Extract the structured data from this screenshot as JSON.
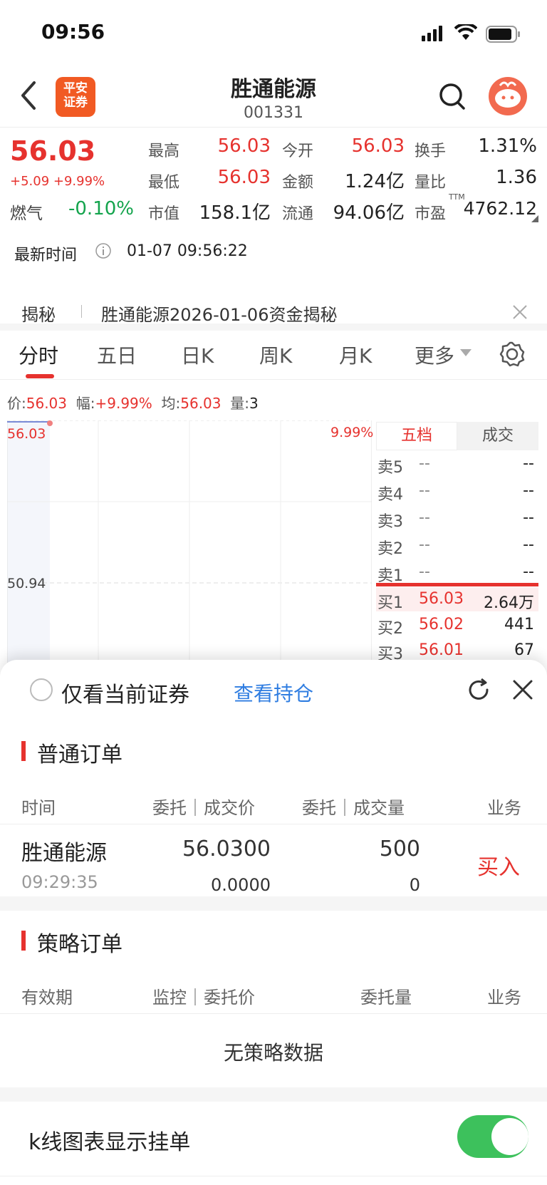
{
  "status_bar": {
    "time": "09:56"
  },
  "header": {
    "logo_text_line1": "平安",
    "logo_text_line2": "证券",
    "title": "胜通能源",
    "code": "001331"
  },
  "quote": {
    "price": "56.03",
    "change": "+5.09 +9.99%",
    "sector_name": "燃气",
    "sector_change": "-0.10%",
    "fields": [
      {
        "label": "最高",
        "value": "56.03"
      },
      {
        "label": "今开",
        "value": "56.03"
      },
      {
        "label": "换手",
        "value": "1.31%"
      },
      {
        "label": "最低",
        "value": "56.03"
      },
      {
        "label": "金额",
        "value": "1.24亿"
      },
      {
        "label": "量比",
        "value": "1.36"
      },
      {
        "label": "市值",
        "value": "158.1亿"
      },
      {
        "label": "流通",
        "value": "94.06亿"
      },
      {
        "label": "市盈",
        "value": "4762.12"
      }
    ],
    "ttm_sup": "TTM",
    "latest_time_label": "最新时间",
    "latest_time": "01-07 09:56:22"
  },
  "banner": {
    "tag": "揭秘",
    "text": "胜通能源2026-01-06资金揭秘"
  },
  "tabs": [
    "分时",
    "五日",
    "日K",
    "周K",
    "月K",
    "更多"
  ],
  "mini_stats": {
    "price_label": "价:",
    "price": "56.03",
    "amp_label": "幅:",
    "amp": "+9.99%",
    "avg_label": "均:",
    "avg": "56.03",
    "vol_label": "量:",
    "vol": "3"
  },
  "chart": {
    "top_price": "56.03",
    "top_pct": "9.99%",
    "mid_price": "50.94"
  },
  "order_book": {
    "tabs": [
      "五档",
      "成交"
    ],
    "sell": [
      {
        "label": "卖5",
        "price": "--",
        "vol": "--"
      },
      {
        "label": "卖4",
        "price": "--",
        "vol": "--"
      },
      {
        "label": "卖3",
        "price": "--",
        "vol": "--"
      },
      {
        "label": "卖2",
        "price": "--",
        "vol": "--"
      },
      {
        "label": "卖1",
        "price": "--",
        "vol": "--"
      }
    ],
    "buy": [
      {
        "label": "买1",
        "price": "56.03",
        "vol": "2.64万"
      },
      {
        "label": "买2",
        "price": "56.02",
        "vol": "441"
      },
      {
        "label": "买3",
        "price": "56.01",
        "vol": "67"
      }
    ]
  },
  "sheet": {
    "only_current_label": "仅看当前证券",
    "view_positions": "查看持仓",
    "normal_orders": {
      "title": "普通订单",
      "headers": [
        "时间",
        "委托｜成交价",
        "委托｜成交量",
        "业务"
      ],
      "rows": [
        {
          "name": "胜通能源",
          "time": "09:29:35",
          "entrust_price": "56.0300",
          "deal_price": "0.0000",
          "entrust_qty": "500",
          "deal_qty": "0",
          "action": "买入"
        }
      ]
    },
    "strategy_orders": {
      "title": "策略订单",
      "headers": [
        "有效期",
        "监控｜委托价",
        "委托量",
        "业务"
      ],
      "empty": "无策略数据"
    },
    "kline_toggle_label": "k线图表显示挂单",
    "kline_toggle_on": true
  }
}
